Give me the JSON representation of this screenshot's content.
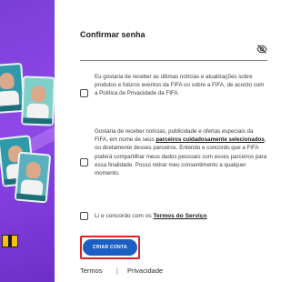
{
  "confirm_password": {
    "label": "Confirmar senha",
    "value": "",
    "placeholder": ""
  },
  "consents": [
    {
      "text": "Eu gostaria de receber as últimas notícias e atualizações sobre produtos e futuros eventos da FIFA ou sobre a FIFA, de acordo com a Política de Privacidade da FIFA."
    },
    {
      "text_before": "Gostaria de receber notícias, publicidade e ofertas especiais da FIFA, em nome de seus ",
      "link": "parceiros cuidadosamente selecionados",
      "text_after": ", ou diretamente desses parceiros. Entendo e concordo que a FIFA poderá compartilhar meus dados pessoais com esses parceiros para essa finalidade. Posso retirar meu consentimento a qualquer momento."
    },
    {
      "text_before": "Li e concordo com os ",
      "link": "Termos do Serviço"
    }
  ],
  "cta": {
    "label": "CRIAR CONTA"
  },
  "footer": {
    "terms": "Termos",
    "separator": "|",
    "privacy": "Privacidade"
  },
  "colors": {
    "accent": "#1c5fc4",
    "highlight": "#d9252a",
    "sidebar": "#7a3fd6"
  },
  "icons": {
    "password_toggle": "eye-slash-icon"
  }
}
